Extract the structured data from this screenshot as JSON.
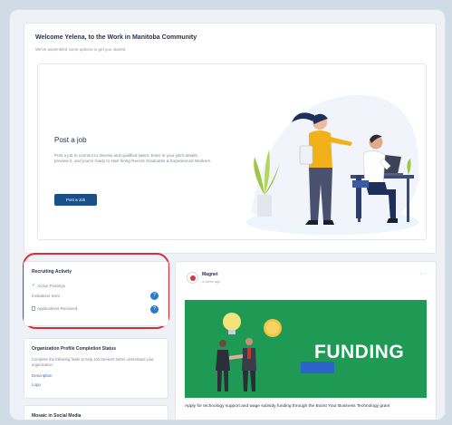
{
  "welcome": {
    "title": "Welcome Yelena, to the Work in Manitoba Community",
    "subtitle": "We've assembled some options to get you started"
  },
  "post_job": {
    "title": "Post a job",
    "description": "Post a job to connect to diverse and qualified talent. Enter in your job's details, preview it, and you're ready to start hiring Recent Graduates & Experienced Workers.",
    "button_label": "Post a Job"
  },
  "recruiting": {
    "title": "Recruiting Activity",
    "rows": [
      {
        "label": "Active Postings",
        "icon": "check-icon"
      },
      {
        "label": "Invitations Sent",
        "badge": "?"
      },
      {
        "label": "Applications Received",
        "badge": "?"
      }
    ]
  },
  "org_profile": {
    "title": "Organization Profile Completion Status",
    "description": "Complete the following fields to help Job Seekers better understand your organization.",
    "links": [
      "Description",
      "Logo"
    ]
  },
  "social": {
    "title": "Mosaic in Social Media"
  },
  "feed": {
    "author": "Magnet",
    "time": "a week ago",
    "more": "···",
    "banner_text": "FUNDING",
    "caption": "Apply for technology support and wage subsidy funding through the Boost Your Business Technology grant"
  },
  "colors": {
    "accent": "#1b4f87",
    "banner": "#1e9a55",
    "highlight": "#d62e3c",
    "badge": "#2a7bc8"
  }
}
